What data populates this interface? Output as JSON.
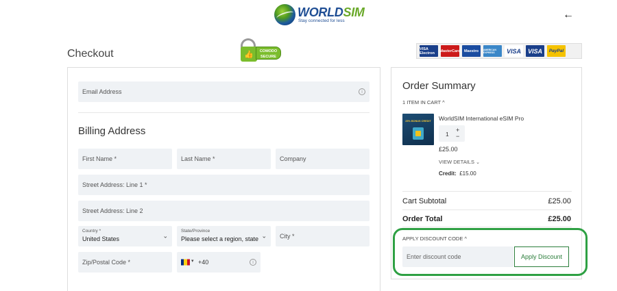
{
  "header": {
    "logo_word_1": "WORLD",
    "logo_word_2": "SIM",
    "logo_tagline": "Stay connected for less",
    "back_arrow": "←"
  },
  "page_title": "Checkout",
  "security_badge": {
    "line1": "COMODO",
    "line2": "SECURE"
  },
  "payment_cards": [
    {
      "name": "VISA Electron",
      "color": "#1a3f8a"
    },
    {
      "name": "MasterCard",
      "color": "#cc1a1a"
    },
    {
      "name": "Maestro",
      "color": "#1a4ca0"
    },
    {
      "name": "AMERICAN EXPRESS",
      "color": "#3b87c8"
    },
    {
      "name": "VISA",
      "color": "#ffffff"
    },
    {
      "name": "VISA",
      "color": "#1a3f8a"
    },
    {
      "name": "PayPal",
      "color": "#f5c200"
    }
  ],
  "email": {
    "placeholder": "Email Address",
    "info_icon": "i"
  },
  "billing": {
    "title": "Billing Address",
    "first_name": "First Name *",
    "last_name": "Last Name *",
    "company": "Company",
    "street1": "Street Address: Line 1 *",
    "street2": "Street Address: Line 2",
    "country_label": "Country *",
    "country_value": "United States",
    "state_label": "State/Province",
    "state_value": "Please select a region, state or province",
    "city": "City *",
    "zip": "Zip/Postal Code *",
    "phone_code": "+40",
    "phone_caret": "▾",
    "info_icon": "i",
    "select_caret": "⌄"
  },
  "order_summary": {
    "title": "Order Summary",
    "items_in_cart": "1 ITEM IN CART",
    "product_thumb_text": "25% BONUS CREDIT",
    "product_name": "WorldSIM International eSIM Pro",
    "quantity": "1",
    "plus": "+",
    "minus": "−",
    "price": "£25.00",
    "view_details": "VIEW DETAILS",
    "credit_label": "Credit:",
    "credit_value": "£15.00",
    "cart_subtotal_label": "Cart Subtotal",
    "cart_subtotal_value": "£25.00",
    "order_total_label": "Order Total",
    "order_total_value": "£25.00",
    "caret_up": "^"
  },
  "discount": {
    "header": "APPLY DISCOUNT CODE",
    "input_placeholder": "Enter discount code",
    "button": "Apply Discount"
  },
  "colors": {
    "highlight": "#2ea043",
    "accent_button": "#2a7d3a",
    "field_bg": "#eff2f5"
  }
}
